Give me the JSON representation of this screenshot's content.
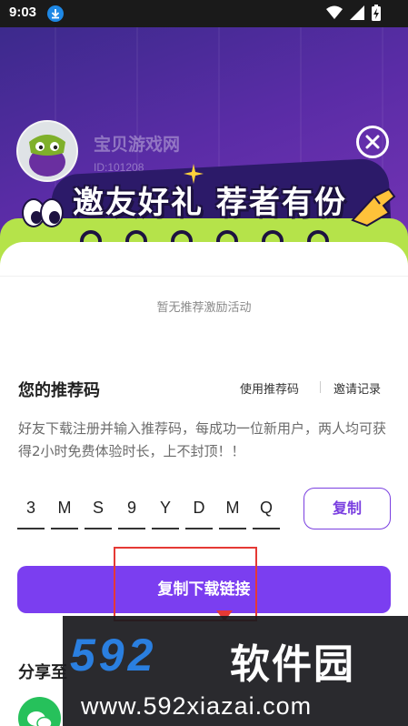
{
  "status_bar": {
    "time": "9:03",
    "icons": [
      "download-icon",
      "wifi-icon",
      "signal-icon",
      "battery-charging-icon"
    ]
  },
  "header": {
    "user_name": "宝贝游戏网",
    "user_id": "ID:101208",
    "banner_title": "邀友好礼 荐者有份"
  },
  "panel": {
    "empty_text": "暂无推荐激励活动",
    "section_title": "您的推荐码",
    "use_code_link": "使用推荐码",
    "invite_record_link": "邀请记录",
    "description": "好友下载注册并输入推荐码，每成功一位新用户，两人均可获得2小时免费体验时长，上不封顶！！",
    "code": [
      "3",
      "M",
      "S",
      "9",
      "Y",
      "D",
      "M",
      "Q"
    ],
    "copy_button": "复制",
    "copy_link_button": "复制下载链接",
    "share_label": "分享至"
  },
  "watermark": {
    "logo": "592",
    "name": "软件园",
    "url": "www.592xiazai.com"
  },
  "colors": {
    "accent": "#7b3ef0",
    "highlight": "#e53935",
    "banner_green": "#b5e34a"
  }
}
